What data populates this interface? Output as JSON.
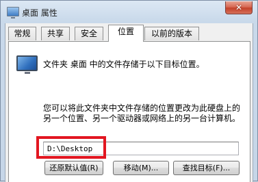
{
  "window": {
    "title": "桌面 属性",
    "close_symbol": "✕"
  },
  "tabs": [
    {
      "label": "常规",
      "active": false
    },
    {
      "label": "共享",
      "active": false
    },
    {
      "label": "安全",
      "active": false
    },
    {
      "label": "位置",
      "active": true
    },
    {
      "label": "以前的版本",
      "active": false
    }
  ],
  "location": {
    "folder_icon": "desktop-folder-icon",
    "info": "文件夹 桌面 中的文件存储于以下目标位置。",
    "description": "您可以将此文件夹中文件存储的位置更改为此硬盘上的另一个位置、另一个驱动器或网络上的另一台计算机。",
    "path_value": "D:\\Desktop",
    "highlight_color": "#e21620"
  },
  "buttons": {
    "restore_default": "还原默认值(R)",
    "move": "移动(M)...",
    "find_target": "查找目标(F)..."
  }
}
